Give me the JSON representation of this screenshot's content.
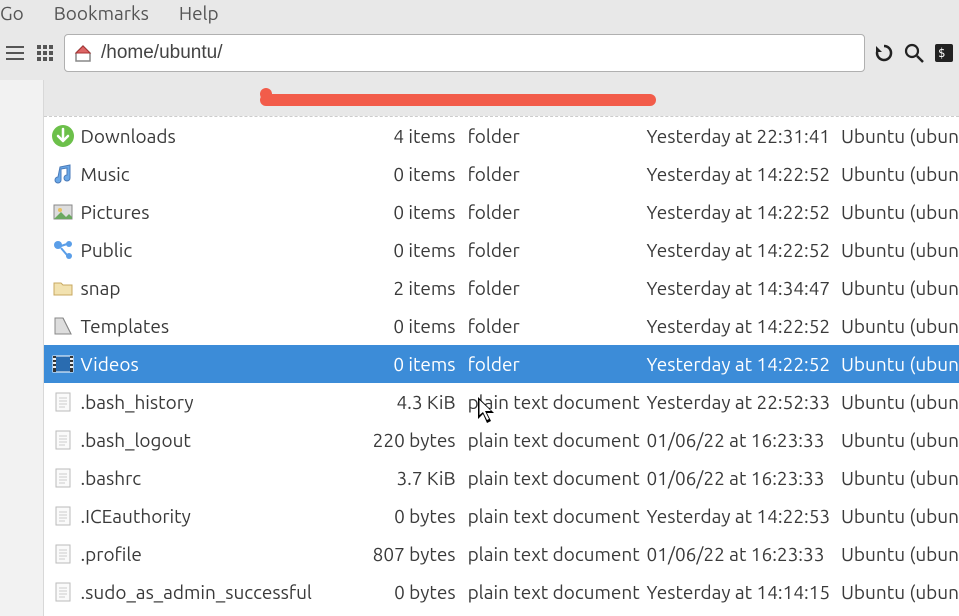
{
  "menu": {
    "go": "Go",
    "bookmarks": "Bookmarks",
    "help": "Help"
  },
  "address": {
    "path": "/home/ubuntu/"
  },
  "rows": [
    {
      "icon": "download",
      "name": "Downloads",
      "size": "4 items",
      "type": "folder",
      "modified": "Yesterday at 22:31:41",
      "owner": "Ubuntu (ubun",
      "selected": false
    },
    {
      "icon": "music",
      "name": "Music",
      "size": "0 items",
      "type": "folder",
      "modified": "Yesterday at 14:22:52",
      "owner": "Ubuntu (ubun",
      "selected": false
    },
    {
      "icon": "pictures",
      "name": "Pictures",
      "size": "0 items",
      "type": "folder",
      "modified": "Yesterday at 14:22:52",
      "owner": "Ubuntu (ubun",
      "selected": false
    },
    {
      "icon": "public",
      "name": "Public",
      "size": "0 items",
      "type": "folder",
      "modified": "Yesterday at 14:22:52",
      "owner": "Ubuntu (ubun",
      "selected": false
    },
    {
      "icon": "folder",
      "name": "snap",
      "size": "2 items",
      "type": "folder",
      "modified": "Yesterday at 14:34:47",
      "owner": "Ubuntu (ubun",
      "selected": false
    },
    {
      "icon": "templates",
      "name": "Templates",
      "size": "0 items",
      "type": "folder",
      "modified": "Yesterday at 14:22:52",
      "owner": "Ubuntu (ubun",
      "selected": false
    },
    {
      "icon": "videos",
      "name": "Videos",
      "size": "0 items",
      "type": "folder",
      "modified": "Yesterday at 14:22:52",
      "owner": "Ubuntu (ubun",
      "selected": true
    },
    {
      "icon": "text",
      "name": ".bash_history",
      "size": "4.3 KiB",
      "type": "plain text document",
      "modified": "Yesterday at 22:52:33",
      "owner": "Ubuntu (ubun",
      "selected": false
    },
    {
      "icon": "text",
      "name": ".bash_logout",
      "size": "220 bytes",
      "type": "plain text document",
      "modified": "01/06/22 at 16:23:33",
      "owner": "Ubuntu (ubun",
      "selected": false
    },
    {
      "icon": "text",
      "name": ".bashrc",
      "size": "3.7 KiB",
      "type": "plain text document",
      "modified": "01/06/22 at 16:23:33",
      "owner": "Ubuntu (ubun",
      "selected": false
    },
    {
      "icon": "text",
      "name": ".ICEauthority",
      "size": "0 bytes",
      "type": "plain text document",
      "modified": "Yesterday at 14:22:53",
      "owner": "Ubuntu (ubun",
      "selected": false
    },
    {
      "icon": "text",
      "name": ".profile",
      "size": "807 bytes",
      "type": "plain text document",
      "modified": "01/06/22 at 16:23:33",
      "owner": "Ubuntu (ubun",
      "selected": false
    },
    {
      "icon": "text",
      "name": ".sudo_as_admin_successful",
      "size": "0 bytes",
      "type": "plain text document",
      "modified": "Yesterday at 14:14:15",
      "owner": "Ubuntu (ubun",
      "selected": false
    }
  ]
}
